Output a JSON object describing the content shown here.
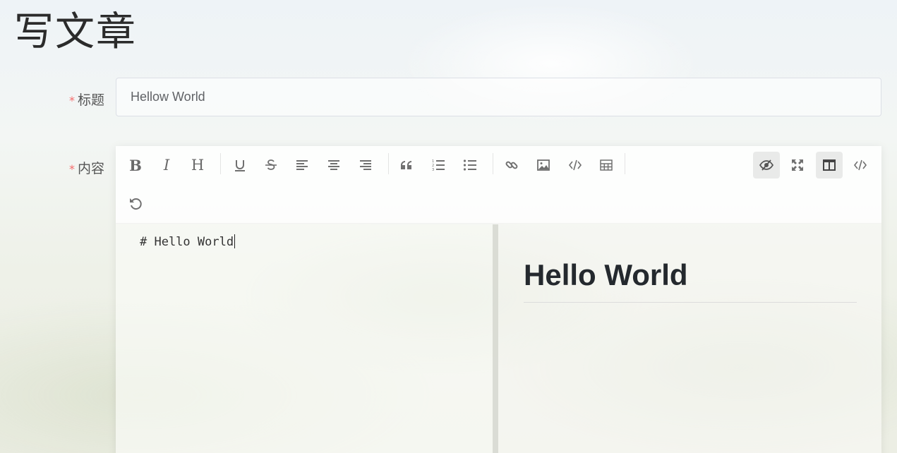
{
  "page": {
    "title": "写文章"
  },
  "form": {
    "required_mark": "*",
    "title_label": "标题",
    "title_value": "Hellow World",
    "content_label": "内容"
  },
  "toolbar": {
    "bold": "B",
    "italic": "I",
    "heading": "H",
    "buttons_row1": [
      "bold",
      "italic",
      "header",
      "underline",
      "strikethrough",
      "align-left",
      "align-center",
      "align-right",
      "blockquote",
      "ordered-list",
      "unordered-list",
      "link",
      "image",
      "code",
      "table"
    ],
    "buttons_right": [
      "preview-toggle",
      "fullscreen",
      "subfield",
      "html-code"
    ],
    "buttons_row2": [
      "undo"
    ],
    "active": [
      "preview-toggle",
      "subfield"
    ]
  },
  "editor": {
    "source": "# Hello World",
    "preview_heading": "Hello World"
  },
  "colors": {
    "required": "#f56c6c",
    "active_bg": "#e6e6e6",
    "icon": "#707070"
  }
}
